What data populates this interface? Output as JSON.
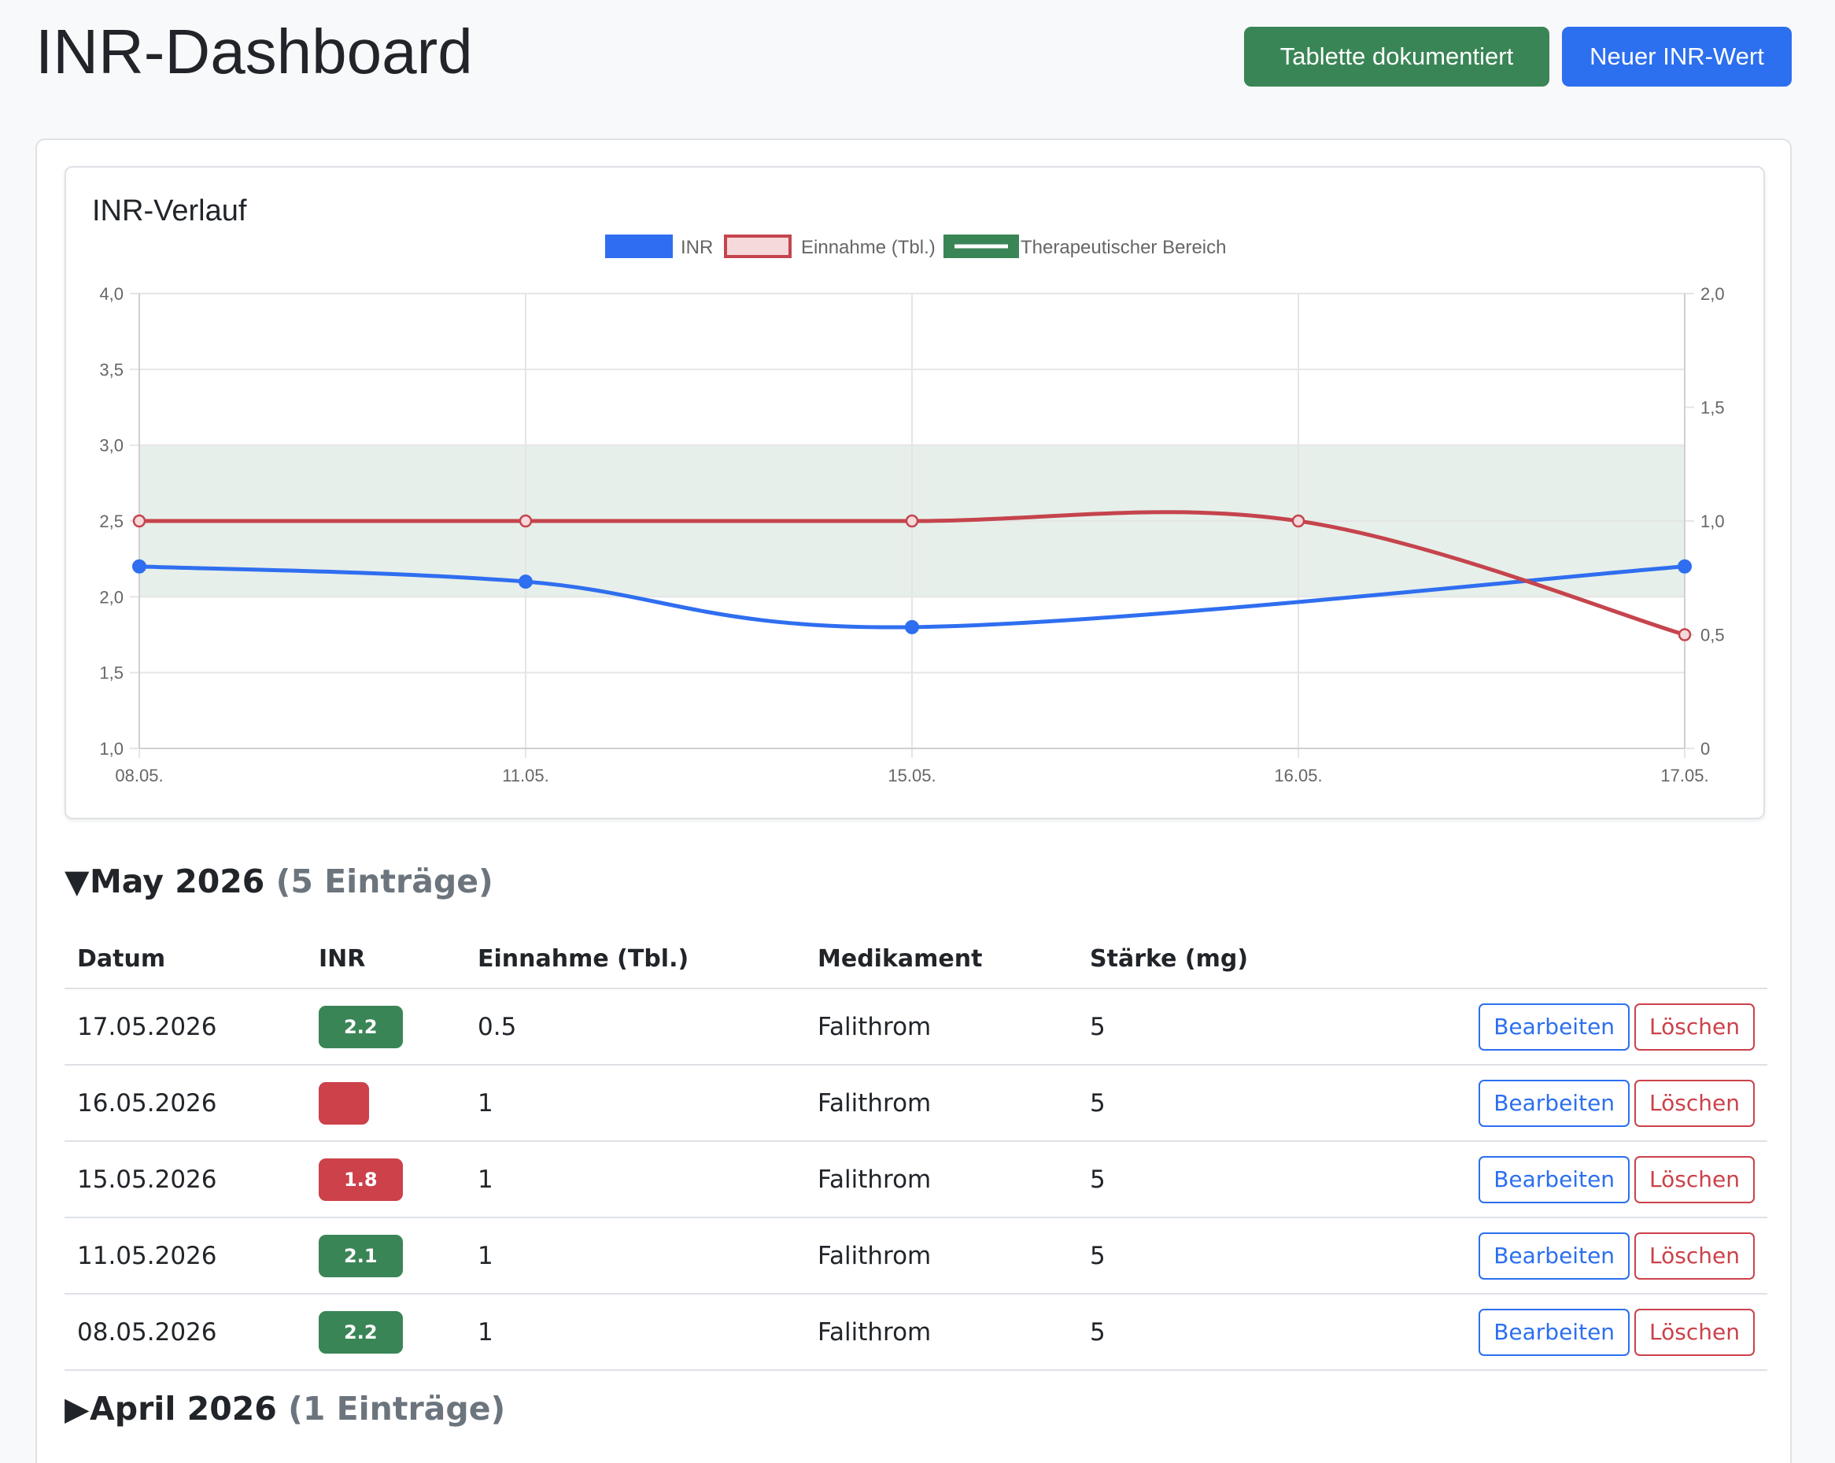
{
  "header": {
    "title": "INR-Dashboard",
    "btn_tablet": "Tablette dokumentiert",
    "btn_new_inr": "Neuer INR-Wert"
  },
  "chart": {
    "title": "INR-Verlauf"
  },
  "chart_data": {
    "type": "line",
    "categories": [
      "08.05.",
      "11.05.",
      "15.05.",
      "16.05.",
      "17.05."
    ],
    "series": [
      {
        "name": "INR",
        "axis": "left",
        "values": [
          2.2,
          2.1,
          1.8,
          null,
          2.2
        ],
        "color": "#2f6ef0"
      },
      {
        "name": "Einnahme (Tbl.)",
        "axis": "right",
        "values": [
          1,
          1,
          1,
          1,
          0.5
        ],
        "color": "#c5444d"
      }
    ],
    "band": {
      "name": "Therapeutischer Bereich",
      "range": [
        2.0,
        3.0
      ],
      "color": "#3a8556"
    },
    "ylim_left": [
      1.0,
      4.0
    ],
    "yticks_left": [
      "1,0",
      "1,5",
      "2,0",
      "2,5",
      "3,0",
      "3,5",
      "4,0"
    ],
    "ylim_right": [
      0,
      2.0
    ],
    "yticks_right": [
      "0",
      "0,5",
      "1,0",
      "1,5",
      "2,0"
    ],
    "grid": true,
    "legend": "top-center"
  },
  "sections": {
    "may": {
      "title": "May 2026",
      "count": "(5 Einträge)",
      "expanded": true
    },
    "april": {
      "title": "April 2026",
      "count": "(1 Einträge)",
      "expanded": false
    }
  },
  "table": {
    "headers": [
      "Datum",
      "INR",
      "Einnahme (Tbl.)",
      "Medikament",
      "Stärke (mg)"
    ],
    "edit_label": "Bearbeiten",
    "delete_label": "Löschen",
    "rows": [
      {
        "date": "17.05.2026",
        "inr": "2.2",
        "status": "ok",
        "intake": "0.5",
        "med": "Falithrom",
        "strength": "5"
      },
      {
        "date": "16.05.2026",
        "inr": "",
        "status": "low",
        "intake": "1",
        "med": "Falithrom",
        "strength": "5"
      },
      {
        "date": "15.05.2026",
        "inr": "1.8",
        "status": "low",
        "intake": "1",
        "med": "Falithrom",
        "strength": "5"
      },
      {
        "date": "11.05.2026",
        "inr": "2.1",
        "status": "ok",
        "intake": "1",
        "med": "Falithrom",
        "strength": "5"
      },
      {
        "date": "08.05.2026",
        "inr": "2.2",
        "status": "ok",
        "intake": "1",
        "med": "Falithrom",
        "strength": "5"
      }
    ]
  },
  "colors": {
    "green": "#3a8556",
    "blue": "#2c6fef",
    "red": "#cc414a"
  }
}
